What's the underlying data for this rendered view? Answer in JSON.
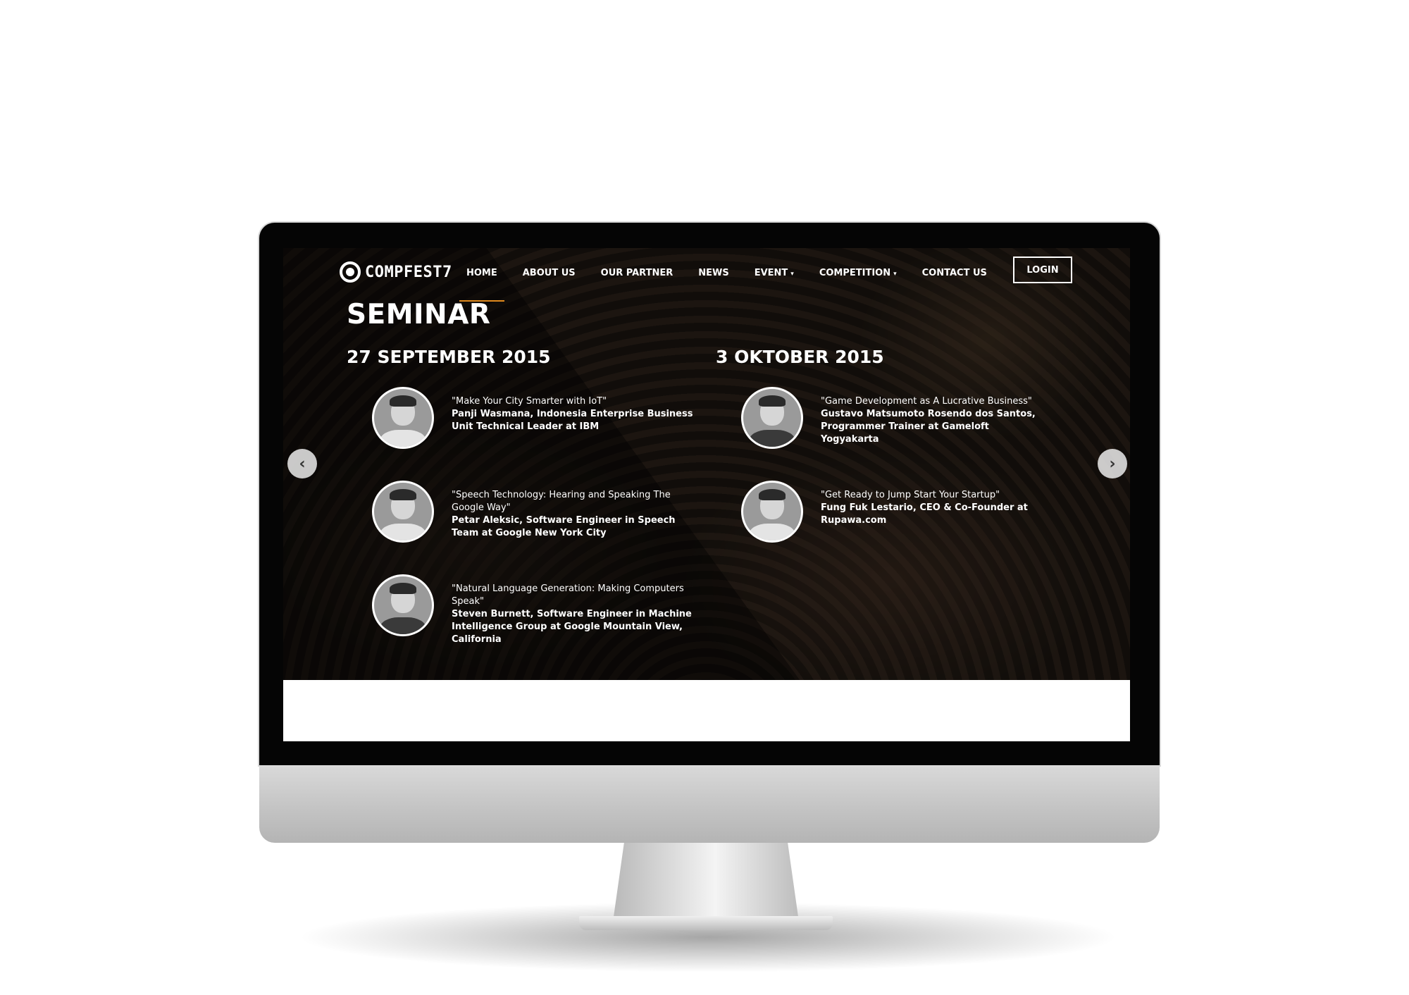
{
  "brand": {
    "logo_text": "COMPFEST7"
  },
  "nav": {
    "items": [
      {
        "label": "HOME",
        "dropdown": false,
        "active": true
      },
      {
        "label": "ABOUT US",
        "dropdown": false
      },
      {
        "label": "OUR PARTNER",
        "dropdown": false
      },
      {
        "label": "NEWS",
        "dropdown": false
      },
      {
        "label": "EVENT",
        "dropdown": true
      },
      {
        "label": "COMPETITION",
        "dropdown": true
      },
      {
        "label": "CONTACT US",
        "dropdown": false
      }
    ],
    "login_label": "LOGIN",
    "caret": "▾",
    "accent_color": "#e08a1e"
  },
  "page": {
    "title": "SEMINAR"
  },
  "schedule": [
    {
      "date": "27 SEPTEMBER 2015",
      "speakers": [
        {
          "topic": "\"Make Your City Smarter with IoT\"",
          "name": "Panji Wasmana, Indonesia Enterprise Business Unit Technical Leader at IBM"
        },
        {
          "topic": "\"Speech Technology: Hearing and Speaking The Google Way\"",
          "name": "Petar Aleksic, Software Engineer in Speech Team at Google New York City"
        },
        {
          "topic": "\"Natural Language Generation: Making Computers Speak\"",
          "name": "Steven Burnett, Software Engineer in Machine Intelligence Group at Google Mountain View, California"
        }
      ]
    },
    {
      "date": "3 OKTOBER 2015",
      "speakers": [
        {
          "topic": "\"Game Development as A Lucrative Business\"",
          "name": "Gustavo Matsumoto Rosendo dos Santos, Programmer Trainer at Gameloft Yogyakarta"
        },
        {
          "topic": "\"Get Ready to Jump Start Your Startup\"",
          "name": "Fung Fuk Lestario, CEO & Co-Founder at Rupawa.com"
        }
      ]
    }
  ],
  "carousel": {
    "prev_icon": "‹",
    "next_icon": "›"
  }
}
